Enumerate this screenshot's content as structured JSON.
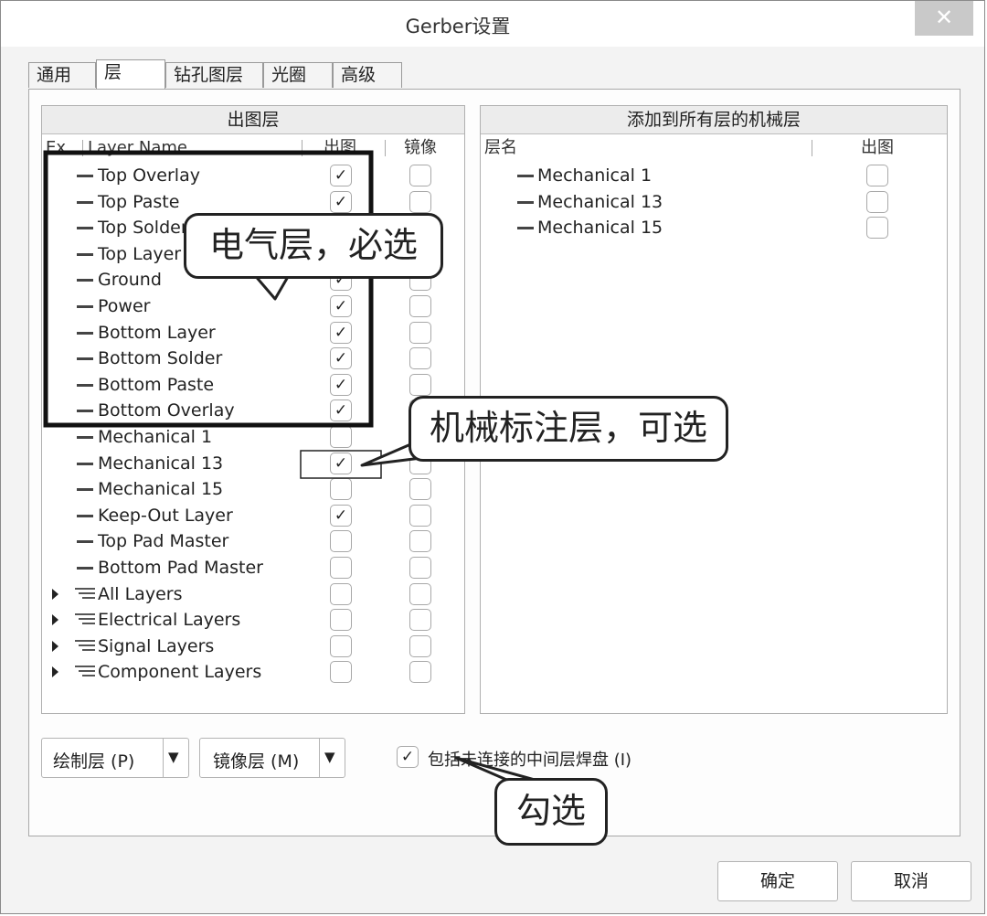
{
  "window": {
    "title": "Gerber设置",
    "close_label": "✕"
  },
  "tabs": [
    {
      "label": "通用"
    },
    {
      "label": "层"
    },
    {
      "label": "钻孔图层"
    },
    {
      "label": "光圈"
    },
    {
      "label": "高级"
    }
  ],
  "left_panel": {
    "title": "出图层",
    "col_ex": "Ex...",
    "col_name": "Layer Name",
    "col_plot": "出图",
    "col_mirror": "镜像",
    "layers": [
      {
        "name": "Top Overlay",
        "plot": true,
        "mirror": false
      },
      {
        "name": "Top Paste",
        "plot": true,
        "mirror": false
      },
      {
        "name": "Top Solder",
        "plot": true,
        "mirror": false
      },
      {
        "name": "Top Layer",
        "plot": true,
        "mirror": false
      },
      {
        "name": "Ground",
        "plot": true,
        "mirror": false
      },
      {
        "name": "Power",
        "plot": true,
        "mirror": false
      },
      {
        "name": "Bottom Layer",
        "plot": true,
        "mirror": false
      },
      {
        "name": "Bottom Solder",
        "plot": true,
        "mirror": false
      },
      {
        "name": "Bottom Paste",
        "plot": true,
        "mirror": false
      },
      {
        "name": "Bottom Overlay",
        "plot": true,
        "mirror": false
      },
      {
        "name": "Mechanical 1",
        "plot": false,
        "mirror": false
      },
      {
        "name": "Mechanical 13",
        "plot": true,
        "mirror": false
      },
      {
        "name": "Mechanical 15",
        "plot": false,
        "mirror": false
      },
      {
        "name": "Keep-Out Layer",
        "plot": true,
        "mirror": false
      },
      {
        "name": "Top Pad Master",
        "plot": false,
        "mirror": false
      },
      {
        "name": "Bottom Pad Master",
        "plot": false,
        "mirror": false
      }
    ],
    "groups": [
      {
        "name": "All Layers"
      },
      {
        "name": "Electrical Layers"
      },
      {
        "name": "Signal Layers"
      },
      {
        "name": "Component Layers"
      }
    ]
  },
  "right_panel": {
    "title": "添加到所有层的机械层",
    "col_name": "层名",
    "col_plot": "出图",
    "layers": [
      {
        "name": "Mechanical 1",
        "plot": false
      },
      {
        "name": "Mechanical 13",
        "plot": false
      },
      {
        "name": "Mechanical 15",
        "plot": false
      }
    ]
  },
  "bottom": {
    "draw_layers_label": "绘制层 (P)",
    "mirror_layers_label": "镜像层 (M)",
    "include_pads_label": "包括未连接的中间层焊盘 (I)",
    "include_pads_checked": true
  },
  "buttons": {
    "ok": "确定",
    "cancel": "取消"
  },
  "annotations": {
    "electrical": "电气层，必选",
    "mechanical": "机械标注层，可选",
    "check": "勾选"
  },
  "icons": {
    "check": "✓",
    "dropdown": "▼"
  }
}
